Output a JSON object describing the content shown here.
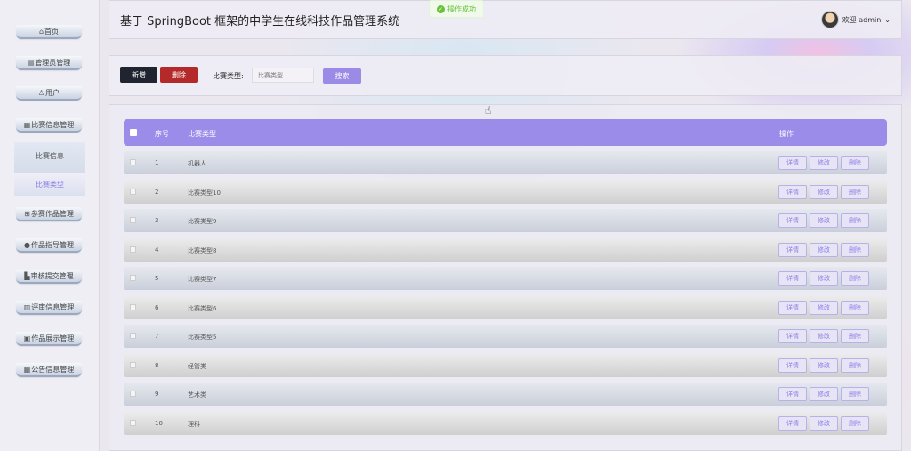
{
  "app": {
    "title": "基于 SpringBoot 框架的中学生在线科技作品管理系统",
    "toast": "操作成功",
    "user": "欢迎 admin"
  },
  "sidebar": {
    "items": [
      {
        "label": "首页",
        "icon": "home-icon",
        "glyph": "⌂"
      },
      {
        "label": "管理员管理",
        "icon": "admin-icon",
        "glyph": "▤"
      },
      {
        "label": "用户",
        "icon": "user-icon",
        "glyph": "♙"
      },
      {
        "label": "比赛信息管理",
        "icon": "contest-icon",
        "glyph": "▦"
      },
      {
        "label": "参赛作品管理",
        "icon": "entry-icon",
        "glyph": "⊞"
      },
      {
        "label": "作品指导管理",
        "icon": "guide-icon",
        "glyph": "●"
      },
      {
        "label": "审核提交管理",
        "icon": "review-icon",
        "glyph": "▙"
      },
      {
        "label": "评审信息管理",
        "icon": "evaluate-icon",
        "glyph": "▥"
      },
      {
        "label": "作品展示管理",
        "icon": "display-icon",
        "glyph": "▣"
      },
      {
        "label": "公告信息管理",
        "icon": "notice-icon",
        "glyph": "▦"
      }
    ],
    "subitems": [
      "比赛信息",
      "比赛类型"
    ]
  },
  "toolbar": {
    "add_label": "新增",
    "delete_label": "删除",
    "filter_label": "比赛类型:",
    "filter_placeholder": "比赛类型",
    "search_label": "搜索"
  },
  "table": {
    "headers": {
      "index": "序号",
      "type": "比赛类型",
      "ops": "操作"
    },
    "rows": [
      {
        "index": "1",
        "type": "机器人"
      },
      {
        "index": "2",
        "type": "比赛类型10"
      },
      {
        "index": "3",
        "type": "比赛类型9"
      },
      {
        "index": "4",
        "type": "比赛类型8"
      },
      {
        "index": "5",
        "type": "比赛类型7"
      },
      {
        "index": "6",
        "type": "比赛类型6"
      },
      {
        "index": "7",
        "type": "比赛类型5"
      },
      {
        "index": "8",
        "type": "经管类"
      },
      {
        "index": "9",
        "type": "艺术类"
      },
      {
        "index": "10",
        "type": "理科"
      }
    ],
    "op_labels": {
      "detail": "详情",
      "edit": "修改",
      "remove": "删除"
    }
  },
  "colors": {
    "accent": "#9a8ce8",
    "danger": "#b42a2a",
    "dark": "#1f2430"
  }
}
